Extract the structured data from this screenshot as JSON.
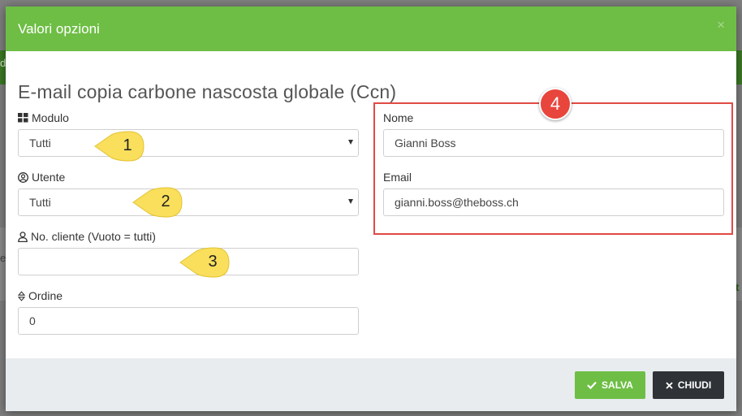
{
  "background": {
    "left_fragment": "d",
    "left_fragment2": "e",
    "right_fragment": "t"
  },
  "modal": {
    "title": "Valori opzioni",
    "close_symbol": "×",
    "section_title": "E-mail copia carbone nascosta globale (Ccn)"
  },
  "form": {
    "modulo": {
      "label": "Modulo",
      "icon": "grid-icon",
      "value": "Tutti"
    },
    "utente": {
      "label": "Utente",
      "icon": "user-circle-icon",
      "value": "Tutti"
    },
    "cliente": {
      "label": "No. cliente (Vuoto = tutti)",
      "icon": "user-icon",
      "value": ""
    },
    "ordine": {
      "label": "Ordine",
      "icon": "sort-icon",
      "value": "0"
    },
    "nome": {
      "label": "Nome",
      "value": "Gianni Boss"
    },
    "email": {
      "label": "Email",
      "value": "gianni.boss@theboss.ch"
    }
  },
  "callouts": [
    "1",
    "2",
    "3",
    "4"
  ],
  "footer": {
    "save_label": "SALVA",
    "close_label": "CHIUDI"
  },
  "colors": {
    "header": "#6ebe45",
    "callout": "#f9df5c",
    "highlight_box": "#e04a45",
    "close_button": "#2f3337"
  }
}
